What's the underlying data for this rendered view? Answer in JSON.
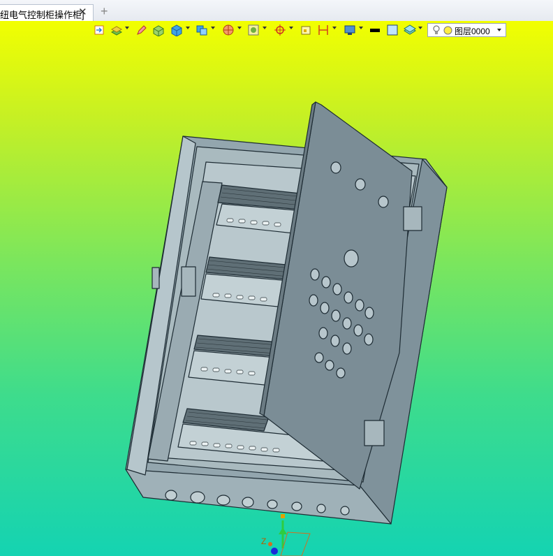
{
  "tab": {
    "title": "纽电气控制柜操作柜]",
    "close_glyph": "✕",
    "add_glyph": "+"
  },
  "toolbar": {
    "icons": [
      "import-icon",
      "layer-stack-icon",
      "pen-icon",
      "box-solid-icon",
      "cube-icon",
      "view-cube-icon",
      "render-mode-icon",
      "frame-icon",
      "snap-target-icon",
      "select-box-icon",
      "dimension-icon",
      "display-settings-icon",
      "line-color-icon",
      "fill-color-icon",
      "material-icon"
    ],
    "layer": {
      "current": "图层0000",
      "bulb_icon": "light-bulb-icon",
      "circle_icon": "layer-color-icon"
    }
  },
  "viewport": {
    "gradient_top": "#f2ff00",
    "gradient_bottom": "#14d3b2",
    "model_color": "#8a9ba4",
    "edge_color": "#1d2b33"
  },
  "axis": {
    "z_label": "Z"
  }
}
